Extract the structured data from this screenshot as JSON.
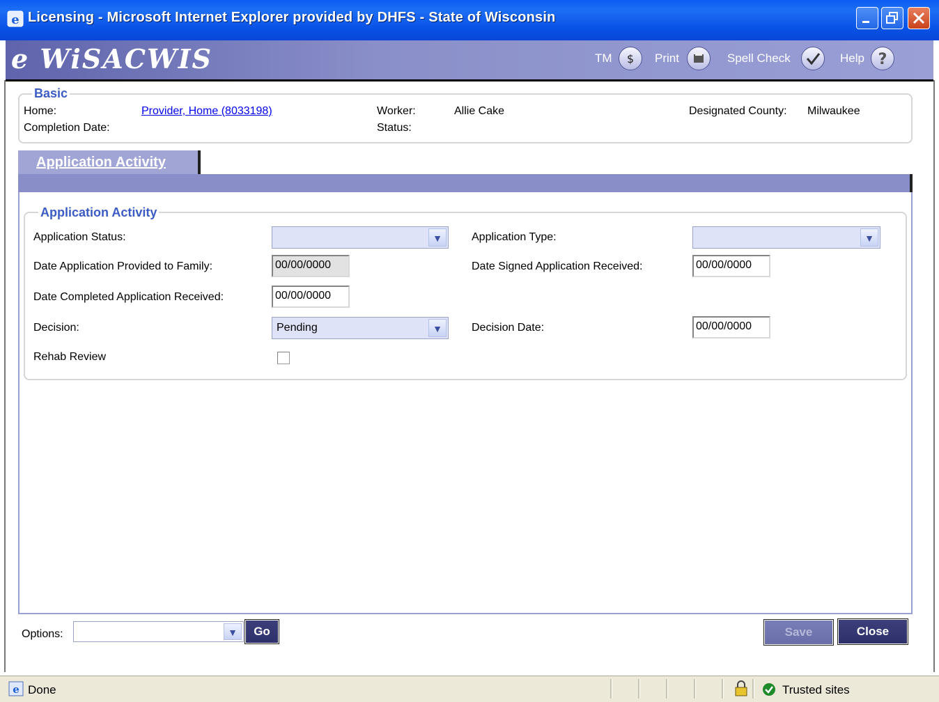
{
  "window": {
    "title": "Licensing - Microsoft Internet Explorer provided by DHFS - State of Wisconsin"
  },
  "header": {
    "logo": "e WiSACWIS",
    "tm_label": "TM",
    "print_label": "Print",
    "spell_label": "Spell Check",
    "help_label": "Help"
  },
  "basic": {
    "legend": "Basic",
    "home_label": "Home:",
    "home_value": "Provider, Home (8033198)",
    "completion_label": "Completion Date:",
    "worker_label": "Worker:",
    "worker_value": "Allie Cake",
    "status_label": "Status:",
    "county_label": "Designated County:",
    "county_value": "Milwaukee"
  },
  "tab": {
    "label": "Application Activity"
  },
  "activity": {
    "legend": "Application Activity",
    "app_status_label": "Application Status:",
    "app_status_value": "",
    "app_type_label": "Application Type:",
    "app_type_value": "",
    "provided_label": "Date Application Provided to Family:",
    "provided_value": "00/00/0000",
    "signed_label": "Date Signed Application Received:",
    "signed_value": "00/00/0000",
    "completed_label": "Date Completed Application Received:",
    "completed_value": "00/00/0000",
    "decision_label": "Decision:",
    "decision_value": "Pending",
    "decision_date_label": "Decision Date:",
    "decision_date_value": "00/00/0000",
    "rehab_label": "Rehab Review",
    "rehab_checked": false
  },
  "footer": {
    "options_label": "Options:",
    "options_value": "",
    "go_label": "Go",
    "save_label": "Save",
    "close_label": "Close"
  },
  "statusbar": {
    "status_text": "Done",
    "zone_text": "Trusted sites"
  }
}
